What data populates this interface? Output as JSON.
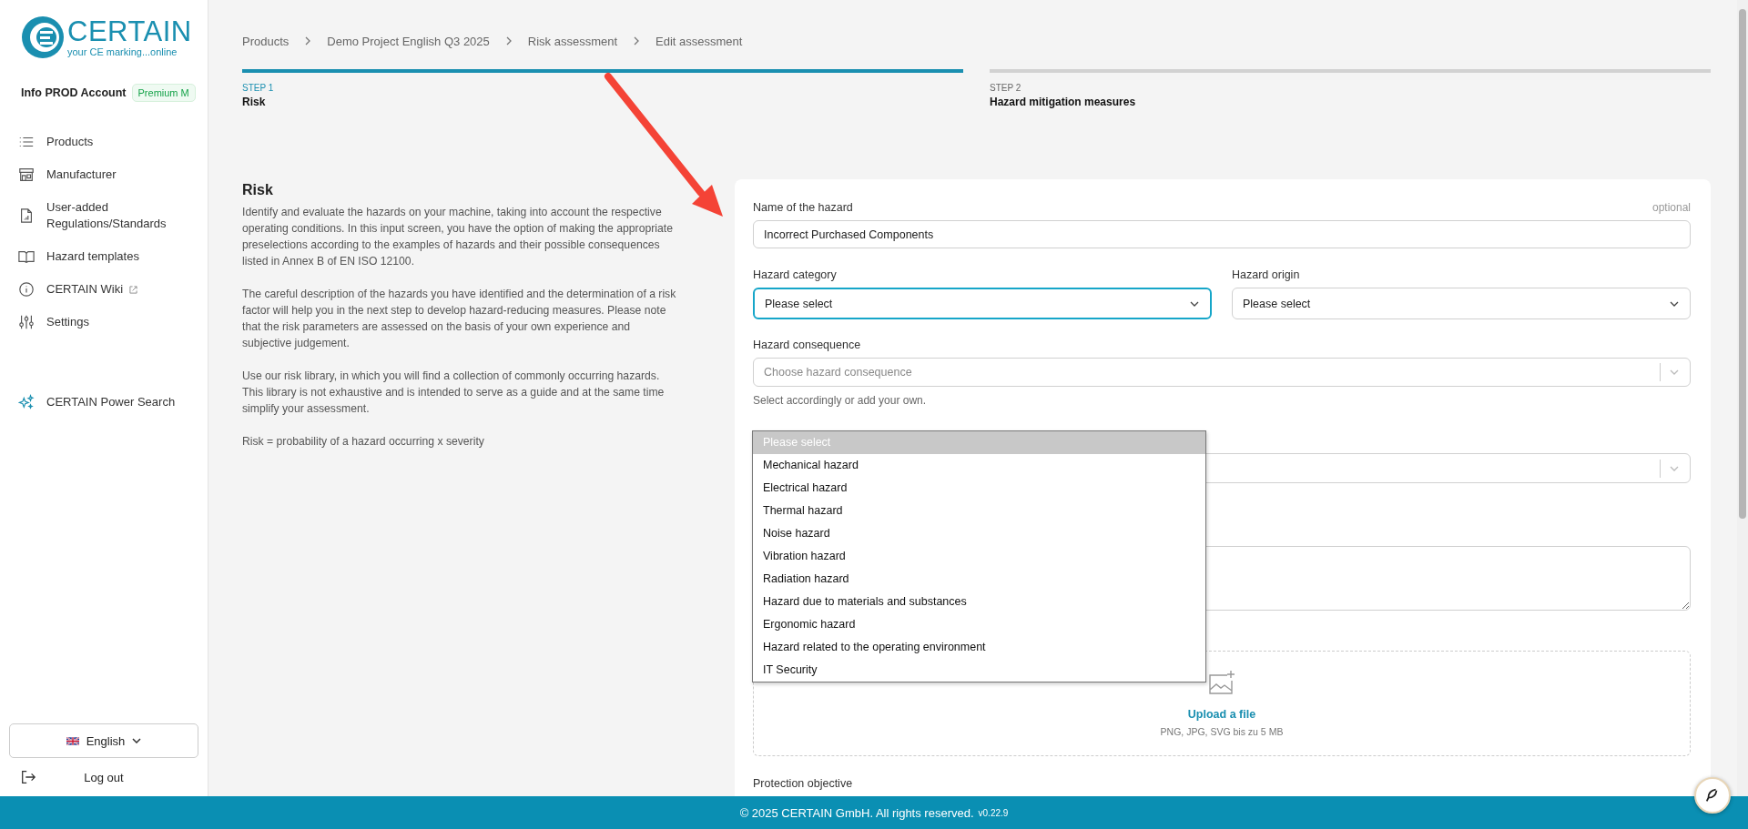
{
  "logo": {
    "name": "CERTAIN",
    "tagline": "your CE marking...online"
  },
  "account": {
    "name": "Info PROD Account",
    "plan": "Premium M"
  },
  "nav": [
    {
      "label": "Products",
      "external": false
    },
    {
      "label": "Manufacturer",
      "external": false
    },
    {
      "label": "User-added Regulations/Standards",
      "external": false
    },
    {
      "label": "Hazard templates",
      "external": false
    },
    {
      "label": "CERTAIN Wiki",
      "external": true
    },
    {
      "label": "Settings",
      "external": false
    }
  ],
  "power_search": {
    "label": "CERTAIN Power Search"
  },
  "language": {
    "label": "English"
  },
  "logout": {
    "label": "Log out"
  },
  "breadcrumb": [
    "Products",
    "Demo Project English Q3 2025",
    "Risk assessment",
    "Edit assessment"
  ],
  "steps": [
    {
      "number": "STEP 1",
      "title": "Risk",
      "selected": true
    },
    {
      "number": "STEP 2",
      "title": "Hazard mitigation measures",
      "selected": false
    }
  ],
  "intro": {
    "title": "Risk",
    "paragraphs": [
      "Identify and evaluate the hazards on your machine, taking into account the respective operating conditions. In this input screen, you have the option of making the appropriate preselections according to the examples of hazards and their possible consequences listed in Annex B of EN ISO 12100.",
      "The careful description of the hazards you have identified and the determination of a risk factor will help you in the next step to develop hazard-reducing measures. Please note that the risk parameters are assessed on the basis of your own experience and subjective judgement.",
      "Use our risk library, in which you will find a collection of commonly occurring hazards. This library is not exhaustive and is intended to serve as a guide and at the same time simplify your assessment.",
      "Risk = probability of a hazard occurring x severity"
    ]
  },
  "form": {
    "name_field": {
      "label": "Name of the hazard",
      "hint": "optional",
      "value": "Incorrect Purchased Components"
    },
    "category": {
      "label": "Hazard category",
      "value": "Please select",
      "focused": true
    },
    "origin": {
      "label": "Hazard origin",
      "value": "Please select",
      "focused": false
    },
    "consequence": {
      "label": "Hazard consequence",
      "placeholder": "Choose hazard consequence",
      "help": "Select accordingly or add your own."
    },
    "upload": {
      "link": "Upload a file",
      "note": "PNG, JPG, SVG bis zu 5 MB"
    },
    "protection_label": "Protection objective"
  },
  "dropdown": {
    "options": [
      {
        "label": "Please select",
        "selected": true
      },
      {
        "label": "Mechanical hazard",
        "selected": false
      },
      {
        "label": "Electrical hazard",
        "selected": false
      },
      {
        "label": "Thermal hazard",
        "selected": false
      },
      {
        "label": "Noise hazard",
        "selected": false
      },
      {
        "label": "Vibration hazard",
        "selected": false
      },
      {
        "label": "Radiation hazard",
        "selected": false
      },
      {
        "label": "Hazard due to materials and substances",
        "selected": false
      },
      {
        "label": "Ergonomic hazard",
        "selected": false
      },
      {
        "label": "Hazard related to the operating environment",
        "selected": false
      },
      {
        "label": "IT Security",
        "selected": false
      }
    ]
  },
  "footer": {
    "copyright": "© 2025 CERTAIN GmbH. All rights reserved.",
    "version": "v0.22.9"
  }
}
